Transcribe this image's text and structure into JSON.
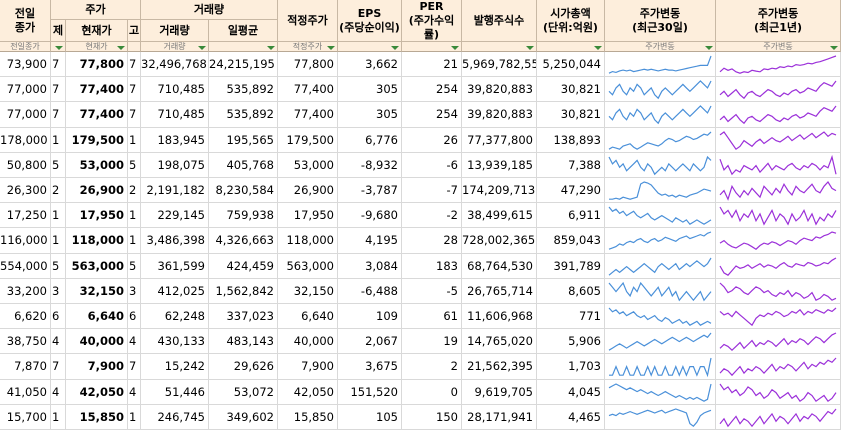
{
  "headers": {
    "prev_close": "전일\n종가",
    "price_group": "주가",
    "price_col_a": "제",
    "current_price": "현재가",
    "price_col_c": "고",
    "volume_group": "거래량",
    "volume": "거래량",
    "volume_avg": "일평균",
    "fair_price": "적정주가",
    "eps": "EPS\n(주당순이익)",
    "per": "PER\n(주가수익률)",
    "shares": "발행주식수",
    "market_cap": "시가총액\n(단위:억원)",
    "trend_30d": "주가변동\n(최근30일)",
    "trend_1y": "주가변동\n(최근1년)"
  },
  "filter_labels": {
    "prev_close": "전일종가",
    "current_price": "현재가",
    "volume": "거래량",
    "fair_price": "적정주가",
    "trend_30d": "주가변동",
    "trend_1y": "주가변동"
  },
  "colors": {
    "trend_30d": "#4a90d9",
    "trend_1y": "#9b30d9",
    "header_bg": "#fdeedc"
  },
  "rows": [
    {
      "prev_close": "73,900",
      "a": "7",
      "price": "77,800",
      "c": "7",
      "volume": "32,496,768",
      "avg": "24,215,195",
      "fair": "77,800",
      "eps": "3,662",
      "per": "21",
      "shares": "5,969,782,55",
      "cap": "5,250,044",
      "s30": [
        40,
        42,
        41,
        43,
        44,
        43,
        44,
        42,
        43,
        44,
        45,
        44,
        45,
        44,
        43,
        44,
        45,
        44,
        44,
        43,
        44,
        45,
        46,
        47,
        48,
        49,
        50,
        50,
        50,
        62
      ],
      "s1y": [
        40,
        45,
        42,
        44,
        40,
        38,
        40,
        39,
        42,
        41,
        40,
        44,
        43,
        45,
        44,
        47,
        46,
        48,
        47,
        50,
        49,
        50,
        52,
        51,
        53,
        54,
        56,
        58,
        60,
        62
      ]
    },
    {
      "prev_close": "77,000",
      "a": "7",
      "price": "77,400",
      "c": "7",
      "volume": "710,485",
      "avg": "535,892",
      "fair": "77,400",
      "eps": "305",
      "per": "254",
      "shares": "39,820,883",
      "cap": "30,821",
      "s30": [
        45,
        44,
        46,
        47,
        45,
        44,
        46,
        45,
        47,
        46,
        44,
        45,
        46,
        44,
        43,
        45,
        46,
        45,
        44,
        45,
        46,
        47,
        46,
        45,
        46,
        47,
        48,
        47,
        46,
        48
      ],
      "s1y": [
        45,
        47,
        44,
        46,
        48,
        45,
        43,
        46,
        47,
        45,
        44,
        46,
        48,
        47,
        45,
        44,
        46,
        45,
        47,
        48,
        46,
        47,
        49,
        48,
        47,
        50,
        52,
        51,
        50,
        53
      ]
    },
    {
      "prev_close": "77,000",
      "a": "7",
      "price": "77,400",
      "c": "7",
      "volume": "710,485",
      "avg": "535,892",
      "fair": "77,400",
      "eps": "305",
      "per": "254",
      "shares": "39,820,883",
      "cap": "30,821",
      "s30": [
        45,
        44,
        46,
        47,
        45,
        44,
        46,
        45,
        47,
        46,
        44,
        45,
        46,
        44,
        43,
        45,
        46,
        45,
        44,
        45,
        46,
        47,
        46,
        45,
        46,
        47,
        48,
        47,
        46,
        48
      ],
      "s1y": [
        45,
        47,
        44,
        46,
        48,
        45,
        43,
        46,
        47,
        45,
        44,
        46,
        48,
        47,
        45,
        44,
        46,
        45,
        47,
        48,
        46,
        47,
        49,
        48,
        47,
        50,
        52,
        51,
        50,
        53
      ]
    },
    {
      "prev_close": "178,000",
      "a": "1",
      "price": "179,500",
      "c": "1",
      "volume": "183,945",
      "avg": "195,565",
      "fair": "179,500",
      "eps": "6,776",
      "per": "26",
      "shares": "77,377,800",
      "cap": "138,893",
      "s30": [
        40,
        42,
        41,
        40,
        43,
        44,
        45,
        42,
        40,
        42,
        44,
        46,
        45,
        44,
        43,
        45,
        48,
        50,
        49,
        47,
        48,
        50,
        52,
        51,
        49,
        50,
        52,
        54,
        53,
        56
      ],
      "s1y": [
        50,
        52,
        48,
        44,
        40,
        42,
        46,
        44,
        42,
        45,
        47,
        44,
        46,
        48,
        46,
        45,
        47,
        49,
        46,
        48,
        50,
        47,
        49,
        51,
        48,
        50,
        52,
        49,
        51,
        50
      ]
    },
    {
      "prev_close": "50,800",
      "a": "5",
      "price": "53,000",
      "c": "5",
      "volume": "198,075",
      "avg": "405,768",
      "fair": "53,000",
      "eps": "-8,932",
      "per": "-6",
      "shares": "13,939,185",
      "cap": "7,388",
      "s30": [
        56,
        54,
        55,
        53,
        54,
        52,
        53,
        54,
        55,
        53,
        52,
        54,
        53,
        51,
        52,
        53,
        52,
        54,
        53,
        52,
        53,
        54,
        53,
        52,
        54,
        53,
        52,
        53,
        56,
        55
      ],
      "s1y": [
        55,
        50,
        52,
        48,
        50,
        49,
        52,
        51,
        50,
        52,
        49,
        51,
        53,
        50,
        52,
        51,
        50,
        52,
        53,
        51,
        50,
        52,
        51,
        53,
        52,
        50,
        52,
        51,
        56,
        48
      ]
    },
    {
      "prev_close": "26,300",
      "a": "2",
      "price": "26,900",
      "c": "2",
      "volume": "2,191,182",
      "avg": "8,230,584",
      "fair": "26,900",
      "eps": "-3,787",
      "per": "-7",
      "shares": "174,209,713",
      "cap": "47,290",
      "s30": [
        40,
        40,
        41,
        40,
        42,
        41,
        40,
        41,
        42,
        55,
        57,
        56,
        54,
        50,
        46,
        44,
        45,
        43,
        44,
        42,
        44,
        43,
        42,
        44,
        45,
        46,
        48,
        50,
        49,
        48
      ],
      "s1y": [
        48,
        50,
        46,
        52,
        49,
        47,
        50,
        48,
        51,
        49,
        47,
        52,
        50,
        48,
        51,
        49,
        53,
        50,
        48,
        52,
        50,
        49,
        51,
        53,
        50,
        49,
        52,
        54,
        51,
        50
      ]
    },
    {
      "prev_close": "17,250",
      "a": "1",
      "price": "17,950",
      "c": "1",
      "volume": "229,145",
      "avg": "759,938",
      "fair": "17,950",
      "eps": "-9,680",
      "per": "-2",
      "shares": "38,499,615",
      "cap": "6,911",
      "s30": [
        52,
        50,
        51,
        49,
        50,
        48,
        49,
        50,
        48,
        47,
        48,
        49,
        47,
        46,
        47,
        48,
        47,
        46,
        45,
        47,
        46,
        45,
        46,
        44,
        45,
        46,
        45,
        44,
        45,
        46
      ],
      "s1y": [
        50,
        48,
        49,
        47,
        49,
        46,
        48,
        47,
        49,
        46,
        48,
        45,
        47,
        49,
        46,
        48,
        47,
        45,
        48,
        46,
        47,
        49,
        46,
        48,
        45,
        47,
        46,
        48,
        47,
        49
      ]
    },
    {
      "prev_close": "116,000",
      "a": "1",
      "price": "118,000",
      "c": "1",
      "volume": "3,486,398",
      "avg": "4,326,663",
      "fair": "118,000",
      "eps": "4,195",
      "per": "28",
      "shares": "728,002,365",
      "cap": "859,043",
      "s30": [
        44,
        45,
        46,
        48,
        47,
        49,
        50,
        49,
        51,
        52,
        50,
        49,
        51,
        52,
        50,
        51,
        53,
        52,
        51,
        50,
        52,
        53,
        54,
        52,
        53,
        54,
        55,
        54,
        56,
        57
      ],
      "s1y": [
        48,
        50,
        47,
        45,
        44,
        46,
        48,
        47,
        45,
        43,
        46,
        48,
        47,
        49,
        48,
        46,
        48,
        50,
        49,
        47,
        50,
        52,
        51,
        50,
        53,
        52,
        54,
        55,
        57,
        56
      ]
    },
    {
      "prev_close": "554,000",
      "a": "5",
      "price": "563,000",
      "c": "5",
      "volume": "361,599",
      "avg": "424,459",
      "fair": "563,000",
      "eps": "3,084",
      "per": "183",
      "shares": "68,764,530",
      "cap": "391,789",
      "s30": [
        48,
        49,
        50,
        49,
        50,
        51,
        50,
        49,
        50,
        51,
        52,
        51,
        50,
        49,
        51,
        52,
        51,
        50,
        51,
        52,
        50,
        51,
        52,
        51,
        52,
        53,
        52,
        51,
        52,
        54
      ],
      "s1y": [
        50,
        44,
        42,
        46,
        50,
        48,
        49,
        51,
        48,
        50,
        52,
        49,
        51,
        50,
        48,
        51,
        53,
        50,
        49,
        52,
        51,
        50,
        53,
        52,
        50,
        51,
        53,
        52,
        55,
        57
      ]
    },
    {
      "prev_close": "33,200",
      "a": "3",
      "price": "32,150",
      "c": "3",
      "volume": "412,025",
      "avg": "1,562,842",
      "fair": "32,150",
      "eps": "-6,488",
      "per": "-5",
      "shares": "26,765,714",
      "cap": "8,605",
      "s30": [
        50,
        49,
        48,
        49,
        50,
        48,
        47,
        49,
        48,
        50,
        49,
        48,
        47,
        48,
        49,
        47,
        48,
        49,
        47,
        48,
        46,
        47,
        48,
        47,
        46,
        47,
        48,
        46,
        47,
        48
      ],
      "s1y": [
        55,
        53,
        50,
        51,
        53,
        52,
        50,
        49,
        51,
        53,
        52,
        50,
        51,
        49,
        48,
        50,
        49,
        51,
        48,
        50,
        49,
        47,
        48,
        50,
        46,
        47,
        49,
        48,
        46,
        47
      ]
    },
    {
      "prev_close": "6,620",
      "a": "6",
      "price": "6,640",
      "c": "6",
      "volume": "62,248",
      "avg": "337,023",
      "fair": "6,640",
      "eps": "109",
      "per": "61",
      "shares": "11,606,968",
      "cap": "771",
      "s30": [
        56,
        54,
        55,
        53,
        54,
        52,
        53,
        54,
        52,
        51,
        52,
        50,
        51,
        52,
        50,
        49,
        51,
        50,
        48,
        49,
        50,
        48,
        49,
        47,
        48,
        49,
        47,
        48,
        49,
        48
      ],
      "s1y": [
        52,
        50,
        51,
        49,
        52,
        50,
        48,
        46,
        44,
        48,
        50,
        49,
        51,
        50,
        52,
        51,
        49,
        50,
        52,
        51,
        53,
        50,
        52,
        51,
        53,
        52,
        51,
        53,
        52,
        54
      ]
    },
    {
      "prev_close": "38,750",
      "a": "4",
      "price": "40,000",
      "c": "4",
      "volume": "430,133",
      "avg": "483,143",
      "fair": "40,000",
      "eps": "2,067",
      "per": "19",
      "shares": "14,765,020",
      "cap": "5,906",
      "s30": [
        46,
        47,
        48,
        49,
        48,
        47,
        48,
        49,
        50,
        49,
        48,
        49,
        50,
        51,
        50,
        49,
        50,
        51,
        52,
        51,
        50,
        51,
        52,
        51,
        50,
        51,
        52,
        53,
        52,
        54
      ],
      "s1y": [
        48,
        50,
        49,
        47,
        49,
        51,
        48,
        50,
        52,
        49,
        51,
        50,
        52,
        51,
        49,
        51,
        53,
        50,
        52,
        51,
        53,
        52,
        50,
        52,
        54,
        53,
        51,
        53,
        55,
        56
      ]
    },
    {
      "prev_close": "7,870",
      "a": "7",
      "price": "7,900",
      "c": "7",
      "volume": "15,242",
      "avg": "29,626",
      "fair": "7,900",
      "eps": "3,675",
      "per": "2",
      "shares": "21,562,395",
      "cap": "1,703",
      "s30": [
        48,
        48,
        49,
        48,
        48,
        49,
        48,
        48,
        49,
        48,
        48,
        49,
        48,
        49,
        48,
        48,
        49,
        48,
        48,
        49,
        48,
        49,
        48,
        49,
        49,
        48,
        49,
        49,
        48,
        50
      ],
      "s1y": [
        46,
        48,
        47,
        45,
        47,
        49,
        46,
        48,
        47,
        49,
        48,
        46,
        48,
        50,
        47,
        49,
        48,
        50,
        49,
        47,
        49,
        51,
        48,
        50,
        49,
        51,
        50,
        52,
        51,
        53
      ]
    },
    {
      "prev_close": "41,050",
      "a": "4",
      "price": "42,050",
      "c": "4",
      "volume": "51,446",
      "avg": "53,072",
      "fair": "42,050",
      "eps": "151,520",
      "per": "0",
      "shares": "9,619,705",
      "cap": "4,045",
      "s30": [
        52,
        53,
        54,
        53,
        52,
        51,
        52,
        51,
        50,
        51,
        50,
        49,
        50,
        49,
        48,
        49,
        50,
        49,
        48,
        47,
        48,
        47,
        46,
        47,
        46,
        47,
        46,
        45,
        46,
        54
      ],
      "s1y": [
        52,
        50,
        51,
        49,
        50,
        48,
        49,
        51,
        50,
        48,
        49,
        47,
        48,
        50,
        49,
        47,
        48,
        49,
        47,
        48,
        46,
        47,
        49,
        48,
        46,
        47,
        48,
        46,
        47,
        49
      ]
    },
    {
      "prev_close": "15,700",
      "a": "1",
      "price": "15,850",
      "c": "1",
      "volume": "246,745",
      "avg": "349,602",
      "fair": "15,850",
      "eps": "105",
      "per": "150",
      "shares": "28,171,941",
      "cap": "4,465",
      "s30": [
        50,
        51,
        50,
        52,
        51,
        52,
        53,
        52,
        51,
        52,
        53,
        54,
        53,
        52,
        53,
        54,
        52,
        53,
        54,
        55,
        54,
        53,
        52,
        44,
        42,
        45,
        50,
        52,
        53,
        54
      ],
      "s1y": [
        48,
        50,
        47,
        49,
        51,
        48,
        50,
        49,
        47,
        49,
        51,
        48,
        50,
        52,
        49,
        51,
        50,
        48,
        50,
        52,
        49,
        51,
        50,
        52,
        51,
        49,
        51,
        53,
        52,
        54
      ]
    }
  ]
}
